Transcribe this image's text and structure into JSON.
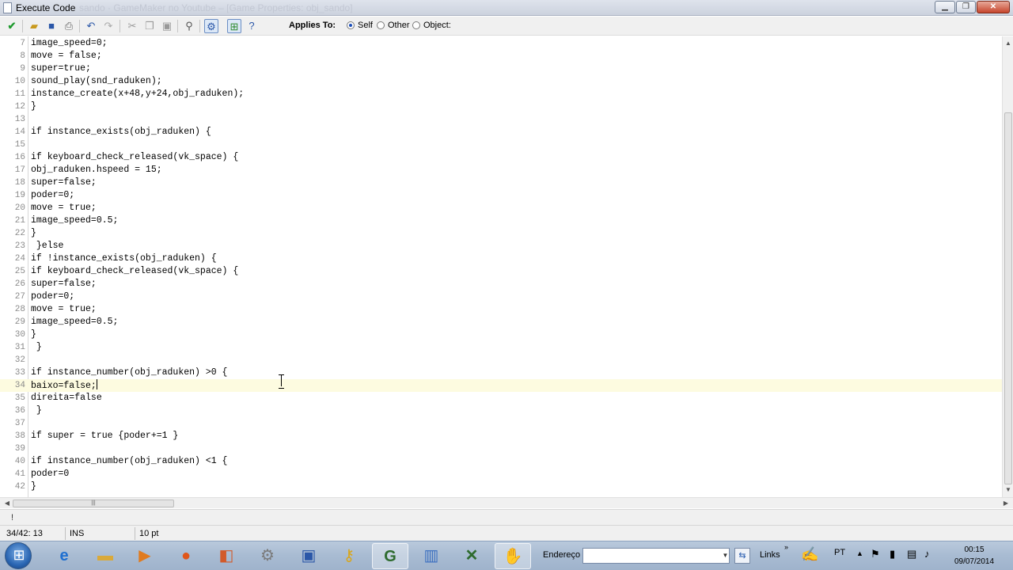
{
  "window": {
    "title": "Execute Code",
    "background_title": "sando · GameMaker no Youtube – [Game Properties: obj_sando]"
  },
  "toolbar": {
    "applies_to_label": "Applies To:",
    "options": [
      {
        "label": "Self",
        "selected": true
      },
      {
        "label": "Other",
        "selected": false
      },
      {
        "label": "Object:",
        "selected": false
      }
    ]
  },
  "editor": {
    "lines": [
      {
        "n": "7",
        "text": "image_speed=0;"
      },
      {
        "n": "8",
        "text": "move = false;"
      },
      {
        "n": "9",
        "text": "super=true;"
      },
      {
        "n": "10",
        "text": "sound_play(snd_raduken);"
      },
      {
        "n": "11",
        "text": "instance_create(x+48,y+24,obj_raduken);"
      },
      {
        "n": "12",
        "text": "}"
      },
      {
        "n": "13",
        "text": ""
      },
      {
        "n": "14",
        "text": "if instance_exists(obj_raduken) {"
      },
      {
        "n": "15",
        "text": ""
      },
      {
        "n": "16",
        "text": "if keyboard_check_released(vk_space) {"
      },
      {
        "n": "17",
        "text": "obj_raduken.hspeed = 15;"
      },
      {
        "n": "18",
        "text": "super=false;"
      },
      {
        "n": "19",
        "text": "poder=0;"
      },
      {
        "n": "20",
        "text": "move = true;"
      },
      {
        "n": "21",
        "text": "image_speed=0.5;"
      },
      {
        "n": "22",
        "text": "}"
      },
      {
        "n": "23",
        "text": " }else"
      },
      {
        "n": "24",
        "text": "if !instance_exists(obj_raduken) {"
      },
      {
        "n": "25",
        "text": "if keyboard_check_released(vk_space) {"
      },
      {
        "n": "26",
        "text": "super=false;"
      },
      {
        "n": "27",
        "text": "poder=0;"
      },
      {
        "n": "28",
        "text": "move = true;"
      },
      {
        "n": "29",
        "text": "image_speed=0.5;"
      },
      {
        "n": "30",
        "text": "}"
      },
      {
        "n": "31",
        "text": " }"
      },
      {
        "n": "32",
        "text": ""
      },
      {
        "n": "33",
        "text": "if instance_number(obj_raduken) >0 {"
      },
      {
        "n": "34",
        "text": "baixo=false;"
      },
      {
        "n": "35",
        "text": "direita=false"
      },
      {
        "n": "36",
        "text": " }"
      },
      {
        "n": "37",
        "text": ""
      },
      {
        "n": "38",
        "text": "if super = true {poder+=1 }"
      },
      {
        "n": "39",
        "text": ""
      },
      {
        "n": "40",
        "text": "if instance_number(obj_raduken) <1 {"
      },
      {
        "n": "41",
        "text": "poder=0"
      },
      {
        "n": "42",
        "text": "}"
      }
    ],
    "current_line": "34"
  },
  "message": "!",
  "status": {
    "position": "34/42: 13",
    "mode": "INS",
    "font_size": "10 pt"
  },
  "taskbar": {
    "address_label": "Endereço",
    "address_value": "",
    "links_label": "Links",
    "language": "PT",
    "time": "00:15",
    "date": "09/07/2014"
  }
}
